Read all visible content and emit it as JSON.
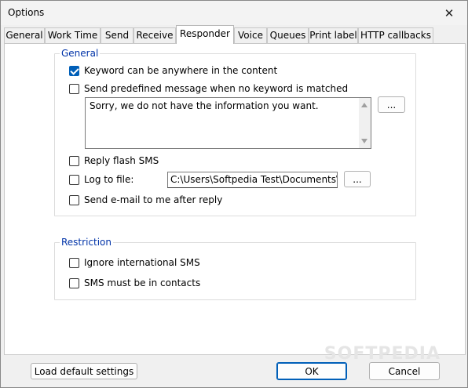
{
  "window": {
    "title": "Options",
    "close_glyph": "✕"
  },
  "tabs": [
    {
      "label": "General"
    },
    {
      "label": "Work Time"
    },
    {
      "label": "Send"
    },
    {
      "label": "Receive"
    },
    {
      "label": "Responder",
      "active": true
    },
    {
      "label": "Voice"
    },
    {
      "label": "Queues"
    },
    {
      "label": "Print label"
    },
    {
      "label": "HTTP callbacks"
    }
  ],
  "general": {
    "label": "General",
    "keyword_anywhere": {
      "label": "Keyword can be anywhere in the content",
      "checked": true
    },
    "send_predefined": {
      "label": "Send predefined message when no keyword is matched",
      "checked": false
    },
    "predefined_message": "Sorry, we do not have the information you want.",
    "browse_label": "...",
    "reply_flash": {
      "label": "Reply flash SMS",
      "checked": false
    },
    "log_to_file": {
      "label": "Log to file:",
      "checked": false
    },
    "log_path": "C:\\Users\\Softpedia Test\\Documents\\S",
    "log_browse_label": "...",
    "send_email": {
      "label": "Send e-mail to me after reply",
      "checked": false
    }
  },
  "restriction": {
    "label": "Restriction",
    "ignore_international": {
      "label": "Ignore international SMS",
      "checked": false
    },
    "must_be_contacts": {
      "label": "SMS must be in contacts",
      "checked": false
    }
  },
  "footer": {
    "load_defaults": "Load default settings",
    "ok": "OK",
    "cancel": "Cancel"
  },
  "watermark": "SOFTPEDIA",
  "colors": {
    "accent": "#005fb8",
    "group_label": "#0033a8"
  }
}
